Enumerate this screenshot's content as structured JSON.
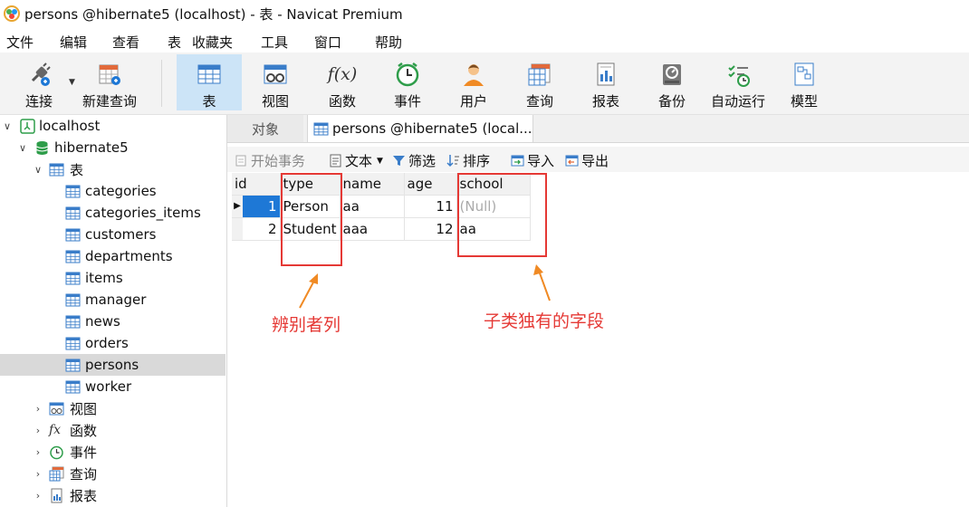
{
  "window": {
    "title": "persons @hibernate5 (localhost) - 表 - Navicat Premium"
  },
  "menu": [
    "文件",
    "编辑",
    "查看",
    "表",
    "收藏夹",
    "工具",
    "窗口",
    "帮助"
  ],
  "toolbar": {
    "connect": "连接",
    "new_query": "新建查询",
    "table": "表",
    "view": "视图",
    "function": "函数",
    "event": "事件",
    "user": "用户",
    "query": "查询",
    "report": "报表",
    "backup": "备份",
    "automation": "自动运行",
    "model": "模型",
    "function_glyph": "f(x)"
  },
  "tree": {
    "connection": "localhost",
    "database": "hibernate5",
    "tables_group": "表",
    "tables": [
      "categories",
      "categories_items",
      "customers",
      "departments",
      "items",
      "manager",
      "news",
      "orders",
      "persons",
      "worker"
    ],
    "selected_table": "persons",
    "other_groups": [
      "视图",
      "函数",
      "事件",
      "查询",
      "报表"
    ],
    "function_glyph": "fx"
  },
  "tabs": {
    "objects": "对象",
    "active": "persons @hibernate5 (local..."
  },
  "subtoolbar": {
    "begin_transaction": "开始事务",
    "text": "文本",
    "filter": "筛选",
    "sort": "排序",
    "import": "导入",
    "export": "导出"
  },
  "grid": {
    "columns": [
      "id",
      "type",
      "name",
      "age",
      "school"
    ],
    "rows": [
      [
        "1",
        "Person",
        "aa",
        "11",
        "(Null)"
      ],
      [
        "2",
        "Student",
        "aaa",
        "12",
        "aa"
      ]
    ]
  },
  "annotations": {
    "discriminator": "辨别者列",
    "subclass_field": "子类独有的字段"
  },
  "colors": {
    "accent": "#1e78d6",
    "annotation": "#e53935",
    "selection": "#cce4f7"
  }
}
